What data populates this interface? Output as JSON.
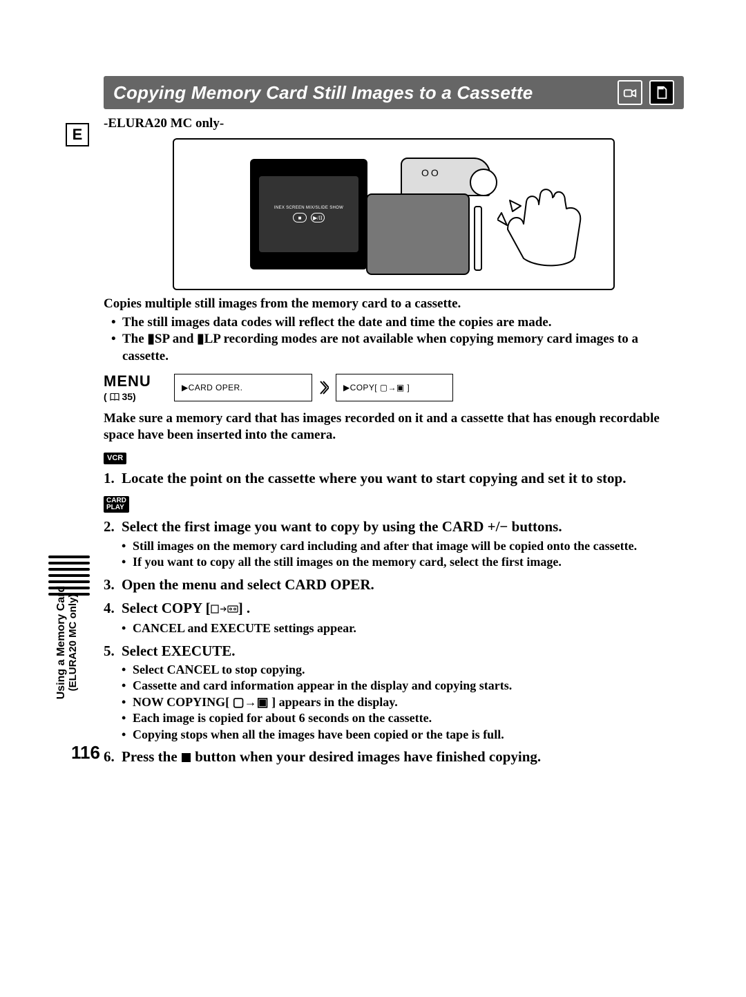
{
  "lang_badge": "E",
  "title": "Copying Memory Card Still Images to a Cassette",
  "subtitle": "-ELURA20 MC only-",
  "illus": {
    "panel_label": "INEX SCREEN   MIX/SLIDE SHOW",
    "btn1": "■",
    "btn2": "▶/II",
    "lens_label": "OO"
  },
  "p1": "Copies multiple still images from the memory card to a cassette.",
  "p1_bullets": [
    "The still images  data codes will reflect the date and time the copies are made.",
    "The ▮SP and ▮LP recording modes are not available when copying memory card images to a cassette."
  ],
  "menu": {
    "label": "MENU",
    "ref_prefix": "( ",
    "ref_page": "35",
    "ref_suffix": ")",
    "box1": "▶CARD  OPER.",
    "box2": "▶COPY[ ▢→▣ ]"
  },
  "prep": "Make sure a memory card that has images recorded on it and a cassette that has enough recordable space have been inserted into the camera.",
  "badge_vcr": "VCR",
  "badge_card": "CARD\nPLAY",
  "steps": {
    "s1": "Locate the point on the cassette where you want to start copying and set it to stop.",
    "s2": "Select the first image you want to copy by using the CARD +/− buttons.",
    "s2_sub": [
      "Still images on the memory card including and after that image will be copied onto the cassette.",
      "If you want to copy all the still images on the memory card, select the first image."
    ],
    "s3": "Open the menu and select CARD OPER.",
    "s4_a": "Select COPY [",
    "s4_b": "] .",
    "s4_sub": [
      "CANCEL and EXECUTE settings appear."
    ],
    "s5": "Select EXECUTE.",
    "s5_sub": [
      "Select CANCEL to stop copying.",
      "Cassette and card information appear in the display and copying starts.",
      "NOW COPYING[ ▢→▣ ]     appears in the display.",
      "Each image is copied for about 6 seconds on the cassette.",
      "Copying stops when all the images have been copied or the tape is full."
    ],
    "s6_a": "Press the ",
    "s6_b": " button when your desired images have finished copying."
  },
  "side": {
    "line1": "Using a Memory Card",
    "line2": "(ELURA20 MC only)"
  },
  "page_number": "116"
}
